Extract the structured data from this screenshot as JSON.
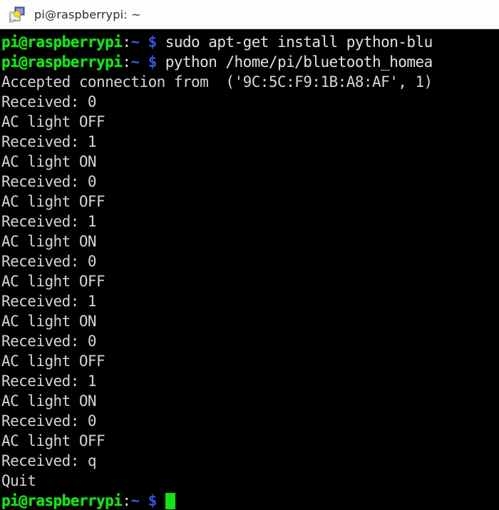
{
  "window": {
    "title": "pi@raspberrypi: ~",
    "icon": "terminal-icon",
    "background": "#000000",
    "titlebar_background": "#fdfdfd"
  },
  "colors": {
    "prompt_user": "#1ae01a",
    "prompt_path": "#2f5fe0",
    "prompt_dollar": "#3355dd",
    "output_text": "#d5d5d5",
    "cursor": "#16e016",
    "terminal_bg": "#000000"
  },
  "prompt": {
    "user_host": "pi@raspberrypi",
    "colon": ":",
    "path": "~",
    "dollar": "$"
  },
  "terminal": {
    "lines": [
      {
        "type": "prompt",
        "command": "sudo apt-get install python-blu"
      },
      {
        "type": "prompt",
        "command": "python /home/pi/bluetooth_homea"
      },
      {
        "type": "output",
        "text": "Accepted connection from  ('9C:5C:F9:1B:A8:AF', 1)"
      },
      {
        "type": "output",
        "text": "Received: 0"
      },
      {
        "type": "output",
        "text": "AC light OFF"
      },
      {
        "type": "output",
        "text": "Received: 1"
      },
      {
        "type": "output",
        "text": "AC light ON"
      },
      {
        "type": "output",
        "text": "Received: 0"
      },
      {
        "type": "output",
        "text": "AC light OFF"
      },
      {
        "type": "output",
        "text": "Received: 1"
      },
      {
        "type": "output",
        "text": "AC light ON"
      },
      {
        "type": "output",
        "text": "Received: 0"
      },
      {
        "type": "output",
        "text": "AC light OFF"
      },
      {
        "type": "output",
        "text": "Received: 1"
      },
      {
        "type": "output",
        "text": "AC light ON"
      },
      {
        "type": "output",
        "text": "Received: 0"
      },
      {
        "type": "output",
        "text": "AC light OFF"
      },
      {
        "type": "output",
        "text": "Received: 1"
      },
      {
        "type": "output",
        "text": "AC light ON"
      },
      {
        "type": "output",
        "text": "Received: 0"
      },
      {
        "type": "output",
        "text": "AC light OFF"
      },
      {
        "type": "output",
        "text": "Received: q"
      },
      {
        "type": "output",
        "text": "Quit"
      },
      {
        "type": "prompt",
        "command": "",
        "cursor": true
      }
    ]
  }
}
